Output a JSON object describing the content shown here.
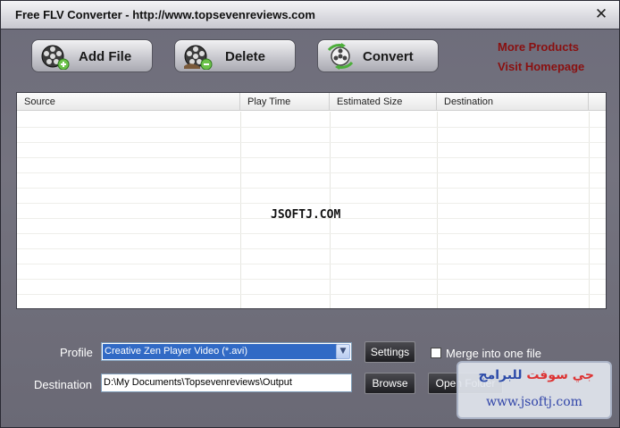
{
  "window": {
    "title": "Free FLV Converter - http://www.topsevenreviews.com",
    "close_glyph": "✕"
  },
  "toolbar": {
    "add_label": "Add File",
    "delete_label": "Delete",
    "convert_label": "Convert"
  },
  "links": {
    "more_products": "More Products",
    "visit_homepage": "Visit Homepage"
  },
  "table": {
    "columns": [
      "Source",
      "Play Time",
      "Estimated Size",
      "Destination"
    ],
    "rows": [],
    "overlay_text": "JSOFTJ.COM"
  },
  "profile": {
    "label": "Profile",
    "selected": "Creative Zen Player Video (*.avi)",
    "settings_label": "Settings"
  },
  "merge": {
    "label": "Merge into one file",
    "checked": false
  },
  "destination": {
    "label": "Destination",
    "value": "D:\\My Documents\\Topsevenreviews\\Output",
    "browse_label": "Browse",
    "open_folder_label": "Open Folder"
  },
  "stamp": {
    "arabic_red": "جي سوفت",
    "arabic_blue": "للبرامج",
    "url": "www.jsoftj.com"
  },
  "colors": {
    "link": "#8a1010",
    "selection": "#316ac5",
    "window_bg": "#6d6c7a"
  }
}
